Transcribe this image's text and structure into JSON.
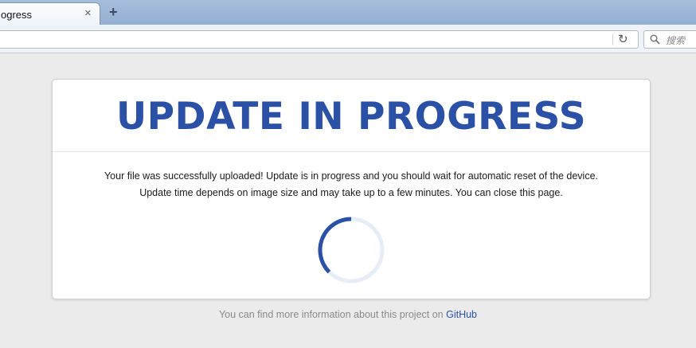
{
  "browser": {
    "tab_title": "ogress",
    "tab_close": "×",
    "new_tab": "+",
    "reload_icon": "↻",
    "search_placeholder": "搜索"
  },
  "page": {
    "title": "UPDATE IN PROGRESS",
    "message_line1": "Your file was successfully uploaded! Update is in progress and you should wait for automatic reset of the device.",
    "message_line2": "Update time depends on image size and may take up to a few minutes. You can close this page.",
    "spinner_icon": "loading-spinner",
    "accent_color": "#2a51a6",
    "footer_text": "You can find more information about this project on ",
    "footer_link": "GitHub"
  }
}
